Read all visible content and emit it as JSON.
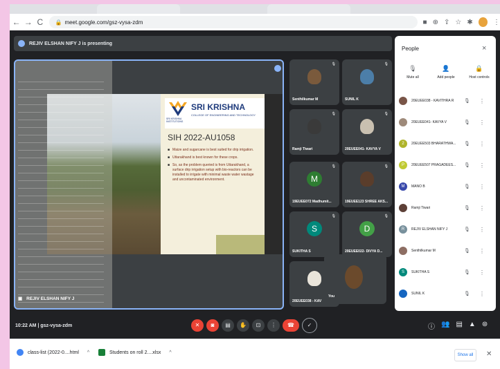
{
  "browser": {
    "url": "meet.google.com/gsz-vysa-zdm",
    "nav": [
      "←",
      "→",
      "C"
    ]
  },
  "meeting": {
    "presenting_text": "REJIV ELSHAN NIFY J is presenting",
    "presenter_name": "REJIV ELSHAN NIFY J",
    "time": "10:22 AM",
    "separator": "|",
    "code": "gsz-vysa-zdm"
  },
  "slide": {
    "college_name": "SRI KRISHNA",
    "college_sub": "COLLEGE OF ENGINEERING AND TECHNOLOGY",
    "logo_small": "SRI KRISHNA INSTITUTIONS",
    "title": "SIH 2022-AU1058",
    "bullets": [
      "Maize and sugarcane is best suited for drip irrigation.",
      "Uttarakhand is best known for these crops.",
      "So, as the problem queried is from Uttarakhand, a surface drip irrigation setup with bio-reactors can be installed to irrigate with minimal waste water wastage and uncontaminated environment."
    ]
  },
  "tiles": [
    {
      "name": "Senthilkumar M",
      "kind": "photo",
      "color": "#7a5a3c"
    },
    {
      "name": "SUNIL K",
      "kind": "photo",
      "color": "#4c7ea8"
    },
    {
      "name": "Ramji Tiwari",
      "kind": "photo",
      "color": "#3a3a3a"
    },
    {
      "name": "20EUEE041- KAVYA V",
      "kind": "photo",
      "color": "#c9c0b0"
    },
    {
      "name": "19EUEE072 Madhumit...",
      "kind": "letter",
      "letter": "M",
      "color": "#2e7d32"
    },
    {
      "name": "19EUEE123 SHREE AKS...",
      "kind": "photo",
      "color": "#5a3d2b"
    },
    {
      "name": "SUKITHA S",
      "kind": "letter",
      "letter": "S",
      "color": "#00897b"
    },
    {
      "name": "20EUEE022- DIVYA D...",
      "kind": "letter",
      "letter": "D",
      "color": "#43a047"
    },
    {
      "name": "20EUEE038 - KAV",
      "kind": "photo",
      "color": "#e9e4da"
    }
  ],
  "self": {
    "label": "You"
  },
  "people": {
    "title": "People",
    "close": "×",
    "actions": [
      {
        "icon": "mute-all-icon",
        "glyph": "🎙",
        "label": "Mute all"
      },
      {
        "icon": "add-people-icon",
        "glyph": "👤",
        "label": "Add people"
      },
      {
        "icon": "host-controls-icon",
        "glyph": "🔒",
        "label": "Host controls"
      }
    ],
    "list": [
      {
        "name": "20EUEE038 - KAVITHRA R",
        "color": "#795548",
        "initial": ""
      },
      {
        "name": "20EUEE041- KAVYA V",
        "color": "#9e8a7a",
        "initial": ""
      },
      {
        "name": "20EUEE503 BHARATHWA...",
        "color": "#afb42b",
        "initial": "2"
      },
      {
        "name": "20EUEE507 PRAGADEES...",
        "color": "#c0ca33",
        "initial": "P"
      },
      {
        "name": "MANO B",
        "color": "#3949ab",
        "initial": "M"
      },
      {
        "name": "Ramji Tiwari",
        "color": "#5d4037",
        "initial": ""
      },
      {
        "name": "REJIV ELSHAN NIFY J",
        "color": "#78909c",
        "initial": "R"
      },
      {
        "name": "Senthilkumar M",
        "color": "#8d6e63",
        "initial": ""
      },
      {
        "name": "SUKITHA S",
        "color": "#00897b",
        "initial": "S"
      },
      {
        "name": "SUNIL K",
        "color": "#1565c0",
        "initial": ""
      }
    ]
  },
  "downloads": [
    {
      "name": "class-list (2022-0....html",
      "color": "#4285f4"
    },
    {
      "name": "Students on roll 2....xlsx",
      "color": "#188038"
    }
  ],
  "show_all": "Show all",
  "colors": {
    "accent": "#8ab4f8",
    "danger": "#ea4335",
    "meet_bg": "#202124"
  }
}
